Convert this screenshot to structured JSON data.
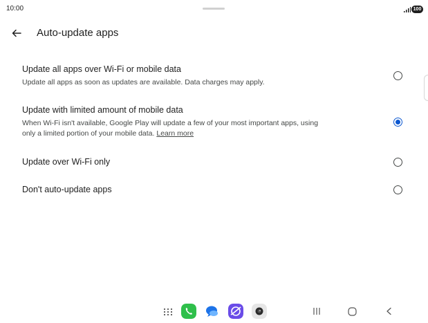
{
  "status_bar": {
    "time": "10:00",
    "battery": "100"
  },
  "header": {
    "title": "Auto-update apps"
  },
  "options": [
    {
      "title": "Update all apps over Wi-Fi or mobile data",
      "description": "Update all apps as soon as updates are available. Data charges may apply.",
      "selected": false
    },
    {
      "title": "Update with limited amount of mobile data",
      "description_line1": "When Wi-Fi isn't available, Google Play will update a few of your most important apps, using",
      "description_line2": "only a limited portion of your mobile data.",
      "link": "Learn more",
      "selected": true
    },
    {
      "title": "Update over Wi-Fi only",
      "selected": false
    },
    {
      "title": "Don't auto-update apps",
      "selected": false
    }
  ],
  "colors": {
    "accent": "#0b57d0",
    "text_primary": "#1f1f1f",
    "text_secondary": "#444746"
  },
  "nav_bar": {
    "icons": [
      "app-drawer-icon",
      "phone-icon",
      "messages-icon",
      "internet-icon",
      "camera-icon",
      "recents-icon",
      "home-icon",
      "back-icon"
    ]
  }
}
